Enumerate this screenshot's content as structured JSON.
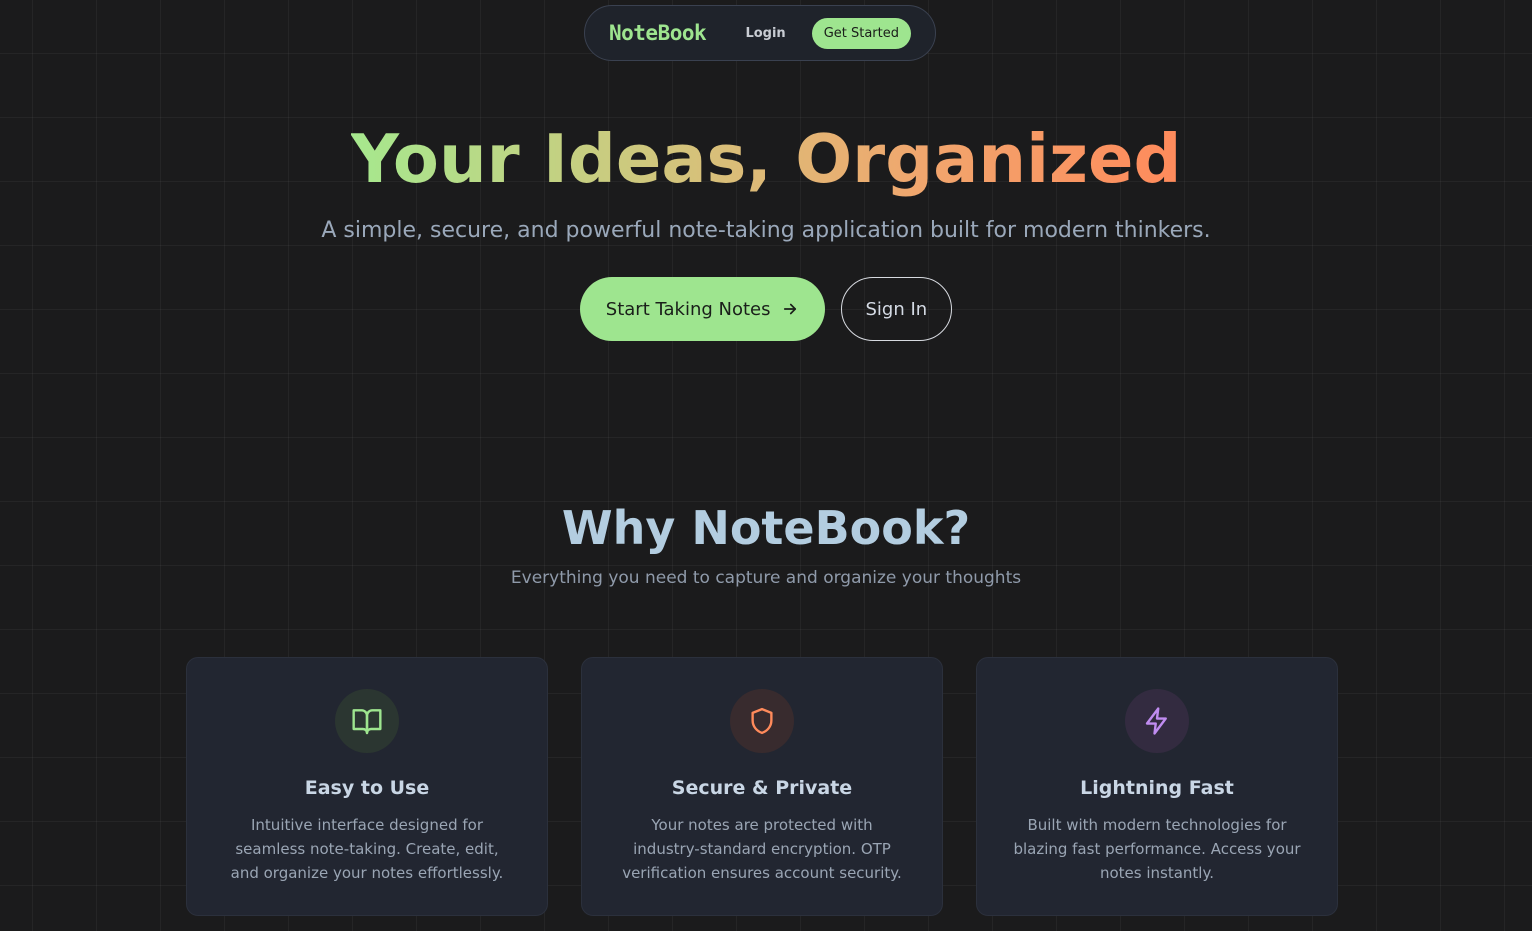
{
  "nav": {
    "brand": "NoteBook",
    "login_label": "Login",
    "cta_label": "Get Started"
  },
  "hero": {
    "title": "Your Ideas, Organized",
    "subtitle": "A simple, secure, and powerful note-taking application built for modern thinkers.",
    "primary_button": "Start Taking Notes",
    "secondary_button": "Sign In"
  },
  "features": {
    "title": "Why NoteBook?",
    "subtitle": "Everything you need to capture and organize your thoughts",
    "cards": [
      {
        "icon": "book-open-icon",
        "title": "Easy to Use",
        "description": "Intuitive interface designed for seamless note-taking. Create, edit, and organize your notes effortlessly.",
        "color": "#9ee58f"
      },
      {
        "icon": "shield-icon",
        "title": "Secure & Private",
        "description": "Your notes are protected with industry-standard encryption. OTP verification ensures account security.",
        "color": "#ff8a5b"
      },
      {
        "icon": "lightning-icon",
        "title": "Lightning Fast",
        "description": "Built with modern technologies for blazing fast performance. Access your notes instantly.",
        "color": "#c08cf0"
      }
    ]
  },
  "colors": {
    "accent": "#9ee58f",
    "background": "#1b1b1c",
    "card": "#222631"
  }
}
